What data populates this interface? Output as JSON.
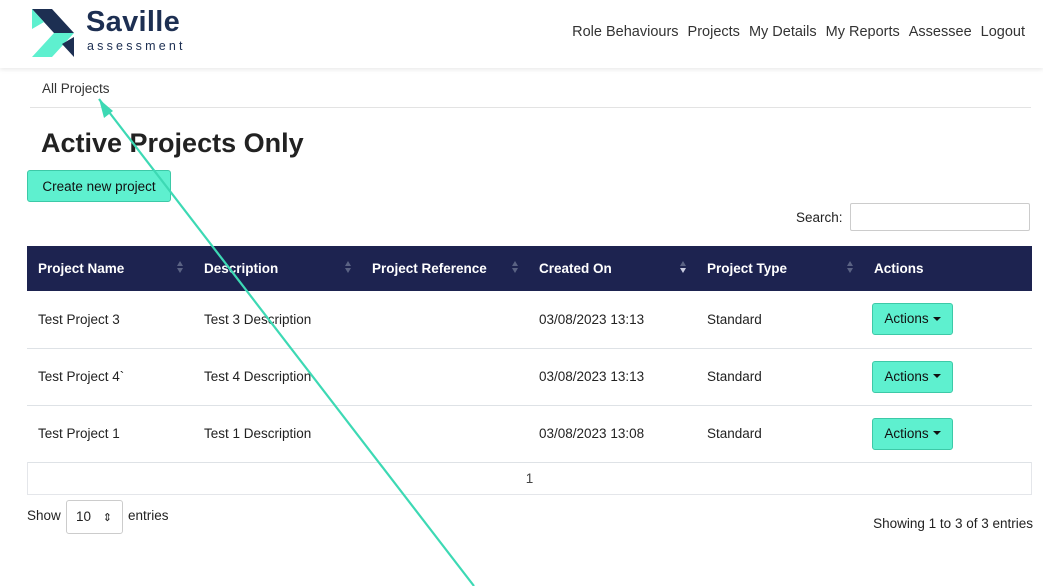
{
  "brand": {
    "name": "Saville",
    "subtitle": "assessment",
    "colors": {
      "navy": "#1d2f52",
      "teal": "#5ef0cf"
    }
  },
  "nav": {
    "items": [
      "Role Behaviours",
      "Projects",
      "My Details",
      "My Reports",
      "Assessee",
      "Logout"
    ]
  },
  "breadcrumb": "All Projects",
  "page_title": "Active Projects Only",
  "create_button": "Create new project",
  "search": {
    "label": "Search:",
    "value": "",
    "placeholder": ""
  },
  "table": {
    "header_bg": "#1d2350",
    "columns": [
      "Project Name",
      "Description",
      "Project Reference",
      "Created On",
      "Project Type",
      "Actions"
    ],
    "sorted_column": "Created On",
    "rows": [
      {
        "name": "Test Project 3",
        "description": "Test 3 Description",
        "reference": "",
        "created": "03/08/2023 13:13",
        "type": "Standard",
        "action": "Actions"
      },
      {
        "name": "Test Project 4`",
        "description": "Test 4 Description",
        "reference": "",
        "created": "03/08/2023 13:13",
        "type": "Standard",
        "action": "Actions"
      },
      {
        "name": "Test Project 1",
        "description": "Test 1 Description",
        "reference": "",
        "created": "03/08/2023 13:08",
        "type": "Standard",
        "action": "Actions"
      }
    ]
  },
  "pagination": {
    "current_page": "1"
  },
  "length": {
    "show": "Show",
    "value": "10",
    "entries": "entries"
  },
  "info": "Showing 1 to 3 of 3 entries",
  "annotation": {
    "type": "arrow",
    "color": "#3dd9b4",
    "points_to": "breadcrumb"
  }
}
